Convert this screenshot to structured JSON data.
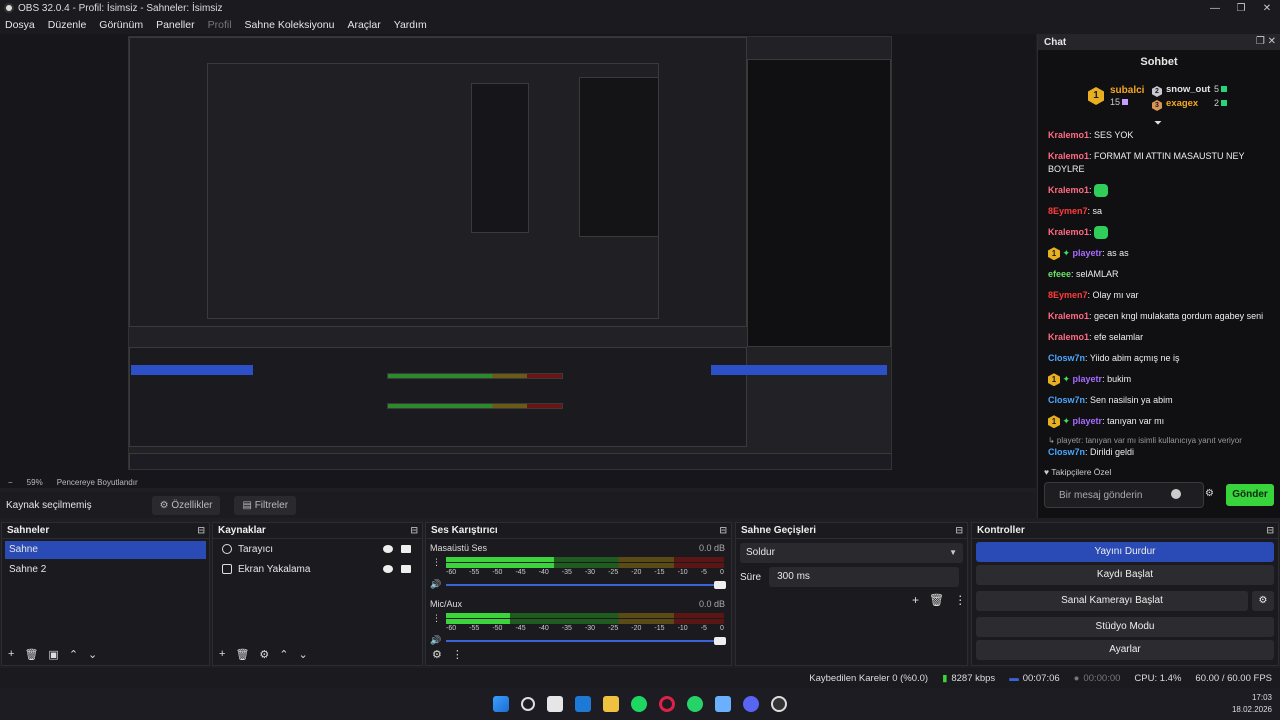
{
  "window": {
    "title": "OBS 32.0.4 - Profil: İsimsiz - Sahneler: İsimsiz",
    "controls": [
      "—",
      "❐",
      "✕"
    ]
  },
  "menu": [
    "Dosya",
    "Düzenle",
    "Görünüm",
    "Paneller",
    "Profil",
    "Sahne Koleksiyonu",
    "Araçlar",
    "Yardım"
  ],
  "preview": {
    "zoom": "59%",
    "fit_label": "Pencereye Boyutlandır"
  },
  "source_toolbar": {
    "status": "Kaynak seçilmemiş",
    "properties_label": "Özellikler",
    "filters_label": "Filtreler"
  },
  "chat": {
    "dock_title": "Chat",
    "title": "Sohbet",
    "leaders": [
      {
        "rank": "1",
        "name": "subalci",
        "count": "15"
      },
      {
        "rank": "2",
        "name": "snow_out",
        "count": "5"
      },
      {
        "rank": "3",
        "name": "exagex",
        "count": "2"
      }
    ],
    "messages": [
      {
        "user": "Kralemo1",
        "text": "SES YOK",
        "color": "#ff6b81"
      },
      {
        "user": "Kralemo1",
        "text": "FORMAT MI ATTIN MASAUSTU NEY BOYLRE",
        "color": "#ff6b81"
      },
      {
        "user": "Kralemo1",
        "text": "",
        "emote": true,
        "color": "#ff6b81"
      },
      {
        "user": "8Eymen7",
        "text": "sa",
        "color": "#ff3b3b"
      },
      {
        "user": "Kralemo1",
        "text": "",
        "emote": true,
        "color": "#ff6b81"
      },
      {
        "user": "playetr",
        "text": "as as",
        "badge": true,
        "color": "#a66bff"
      },
      {
        "user": "efeee",
        "text": "selAMLAR",
        "color": "#6be06b"
      },
      {
        "user": "8Eymen7",
        "text": "Olay mı var",
        "color": "#ff3b3b"
      },
      {
        "user": "Kralemo1",
        "text": "gecen kngl mulakatta gordum agabey seni",
        "color": "#ff6b81"
      },
      {
        "user": "Kralemo1",
        "text": "efe selamlar",
        "color": "#ff6b81"
      },
      {
        "user": "Closw7n",
        "text": "Yiido abim açmış ne iş",
        "color": "#4aa8ff"
      },
      {
        "user": "playetr",
        "text": "bukim",
        "badge": true,
        "color": "#a66bff"
      },
      {
        "user": "Closw7n",
        "text": "Sen nasilsin ya abim",
        "color": "#4aa8ff"
      },
      {
        "user": "playetr",
        "text": "tanıyan var mı",
        "badge": true,
        "color": "#a66bff"
      },
      {
        "user": "Closw7n",
        "text": "Dirildi geldi",
        "color": "#4aa8ff",
        "reply": "playetr: tanıyan var mı isimli kullanıcıya yanıt veriyor"
      }
    ],
    "follower_label": "Takipçilere Özel",
    "input_placeholder": "Bir mesaj gönderin",
    "send_label": "Gönder"
  },
  "scenes": {
    "title": "Sahneler",
    "items": [
      "Sahne",
      "Sahne 2"
    ],
    "selected": 0
  },
  "sources": {
    "title": "Kaynaklar",
    "items": [
      "Tarayıcı",
      "Ekran Yakalama"
    ]
  },
  "mixer": {
    "title": "Ses Karıştırıcı",
    "tracks": [
      {
        "name": "Masaüstü Ses",
        "db": "0.0 dB",
        "level": 0.39
      },
      {
        "name": "Mic/Aux",
        "db": "0.0 dB",
        "level": 0.23
      }
    ],
    "ticks": [
      "-60",
      "-55",
      "-50",
      "-45",
      "-40",
      "-35",
      "-30",
      "-25",
      "-20",
      "-15",
      "-10",
      "-5",
      "0"
    ]
  },
  "transitions": {
    "title": "Sahne Geçişleri",
    "selected": "Soldur",
    "duration_label": "Süre",
    "duration_value": "300 ms"
  },
  "controls": {
    "title": "Kontroller",
    "buttons": [
      "Yayını Durdur",
      "Kaydı Başlat",
      "Sanal Kamerayı Başlat",
      "Stüdyo Modu",
      "Ayarlar"
    ]
  },
  "status": {
    "dropped": "Kaybedilen Kareler 0 (%0.0)",
    "bitrate": "8287 kbps",
    "stream_time": "00:07:06",
    "record_time": "00:00:00",
    "cpu": "CPU: 1.4%",
    "fps": "60.00 / 60.00 FPS"
  },
  "taskbar": {
    "time": "17:03",
    "date": "18.02.2026"
  },
  "colors": {
    "accent": "#2a4bb5",
    "send": "#37d43c"
  }
}
